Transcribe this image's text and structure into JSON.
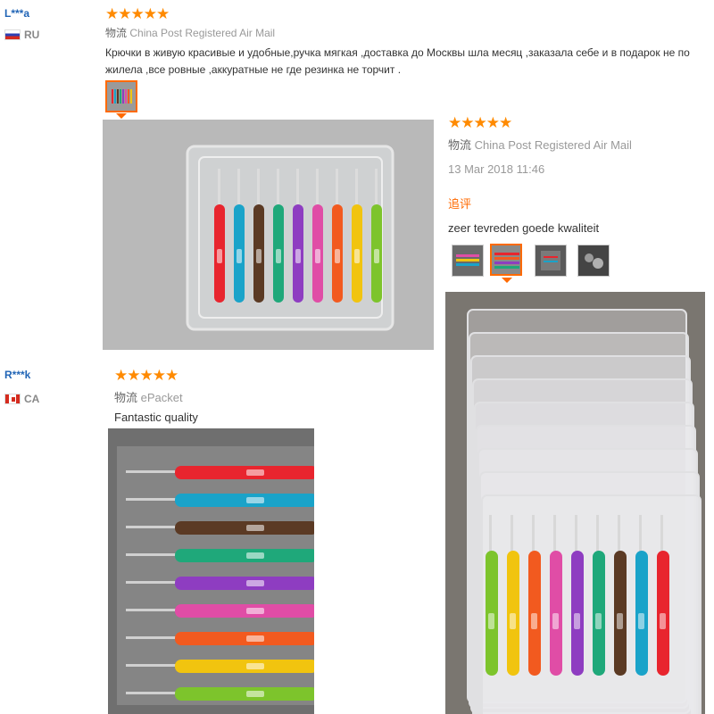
{
  "reviews": [
    {
      "user": "L***a",
      "country": "RU",
      "stars": "★★★★★",
      "logistics_label": "物流",
      "logistics": "China Post Registered Air Mail",
      "text": "Крючки в живую красивые и удобные,ручка мягкая ,доставка до Москвы шла месяц ,заказала себе и в подарок не по жилела ,все ровные ,аккуратные не где резинка не торчит ."
    },
    {
      "stars": "★★★★★",
      "logistics_label": "物流",
      "logistics": "China Post Registered Air Mail",
      "date": "13 Mar 2018 11:46",
      "followup_label": "追评",
      "text": "zeer tevreden goede kwaliteit"
    },
    {
      "user": "R***k",
      "country": "CA",
      "stars": "★★★★★",
      "logistics_label": "物流",
      "logistics": "ePacket",
      "text": "Fantastic quality"
    }
  ],
  "colors": {
    "accent": "#ff6a00",
    "star": "#ff8a00",
    "username": "#2165b6",
    "hook_colors": [
      "#e8252e",
      "#1aa3c9",
      "#5b3a24",
      "#1fa87a",
      "#8e3dc1",
      "#e04da6",
      "#f25a1f",
      "#f1c40f",
      "#7dc42c"
    ]
  }
}
